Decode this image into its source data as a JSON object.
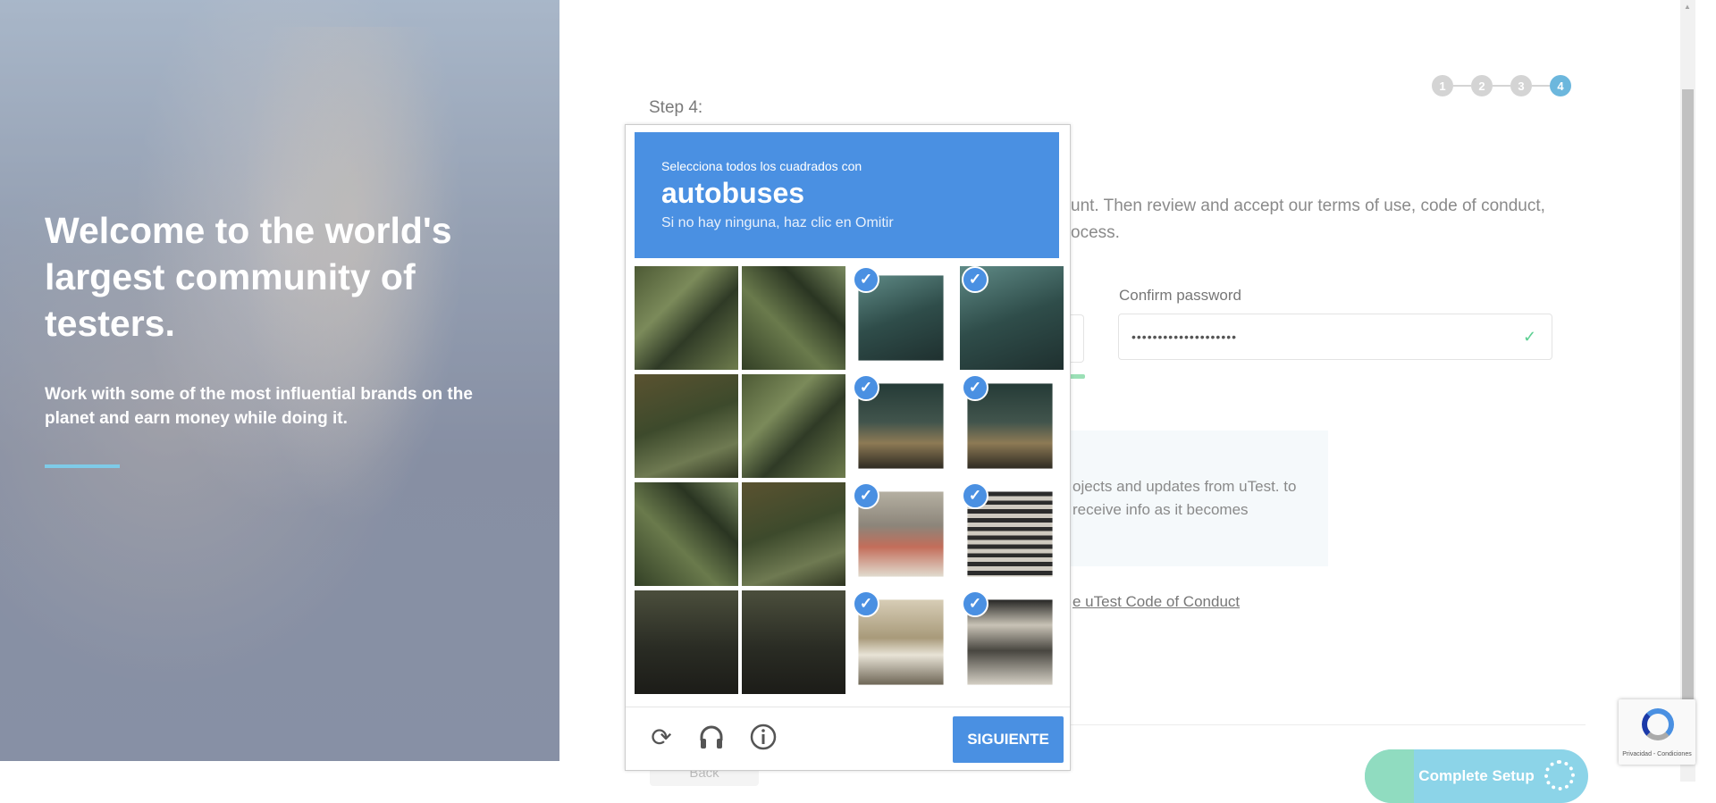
{
  "hero": {
    "title": "Welcome to the world's largest community of testers.",
    "subtitle": "Work with some of the most influential brands on the planet and earn money while doing it."
  },
  "stepper": {
    "steps": [
      "1",
      "2",
      "3",
      "4"
    ],
    "active": "4"
  },
  "form": {
    "step_label": "Step 4:",
    "intro_text": "unt. Then review and accept our terms of use, code of conduct, ocess.",
    "confirm_password_label": "Confirm password",
    "confirm_password_value": "••••••••••••••••••••",
    "info_text": "ojects and updates from uTest. to receive info as it becomes",
    "coc_link": "e uTest Code of Conduct",
    "back_label": "Back",
    "complete_label": "Complete Setup"
  },
  "captcha": {
    "instruction": "Selecciona todos los cuadrados con",
    "keyword": "autobuses",
    "note": "Si no hay ninguna, haz clic en Omitir",
    "verify_label": "SIGUIENTE",
    "icons": [
      "reload-icon",
      "headphones-icon",
      "info-icon"
    ],
    "tiles": [
      {
        "id": 1,
        "selected": false
      },
      {
        "id": 2,
        "selected": false
      },
      {
        "id": 3,
        "selected": true
      },
      {
        "id": 4,
        "selected": true
      },
      {
        "id": 5,
        "selected": false
      },
      {
        "id": 6,
        "selected": false
      },
      {
        "id": 7,
        "selected": true
      },
      {
        "id": 8,
        "selected": true
      },
      {
        "id": 9,
        "selected": false
      },
      {
        "id": 10,
        "selected": false
      },
      {
        "id": 11,
        "selected": true
      },
      {
        "id": 12,
        "selected": true
      },
      {
        "id": 13,
        "selected": false
      },
      {
        "id": 14,
        "selected": false
      },
      {
        "id": 15,
        "selected": true
      },
      {
        "id": 16,
        "selected": true
      }
    ]
  },
  "recaptcha": {
    "terms": "Privacidad - Condiciones"
  },
  "colors": {
    "captcha_blue": "#4a90e2",
    "accent_teal": "#6cb7dd",
    "success_green": "#5ccf92"
  }
}
